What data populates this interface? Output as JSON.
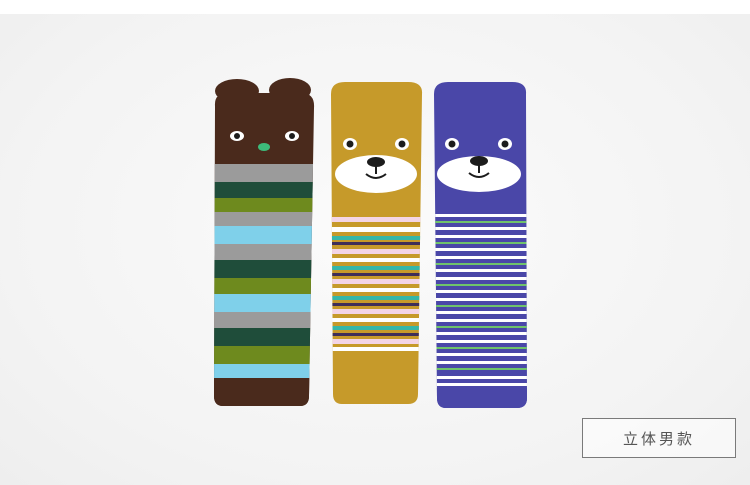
{
  "product_label": "立体男款",
  "socks": [
    {
      "name": "brown-bear",
      "base": "#4a2a1c",
      "ear": "#4a2a1c",
      "nose": "#3dbb7a",
      "stripes": [
        "#9b9b9b",
        "#1f4d3a",
        "#7fd0ea",
        "#6e8a1e",
        "#9b9b9b",
        "#1f4d3a",
        "#7fd0ea",
        "#6e8a1e"
      ]
    },
    {
      "name": "yellow-bear",
      "base": "#c69a2a",
      "ear": "#e35a9a",
      "nose": "#1c1c1c",
      "stripes": [
        "#f3d5e6",
        "#36b7a8",
        "#3e2e58",
        "#ffffff"
      ]
    },
    {
      "name": "blue-bear",
      "base": "#4a47a8",
      "ear": "#4fd0c0",
      "nose": "#1c1c1c",
      "stripes": [
        "#ffffff",
        "#6fc36b",
        "#ffffff",
        "#2d2c7a"
      ]
    }
  ]
}
